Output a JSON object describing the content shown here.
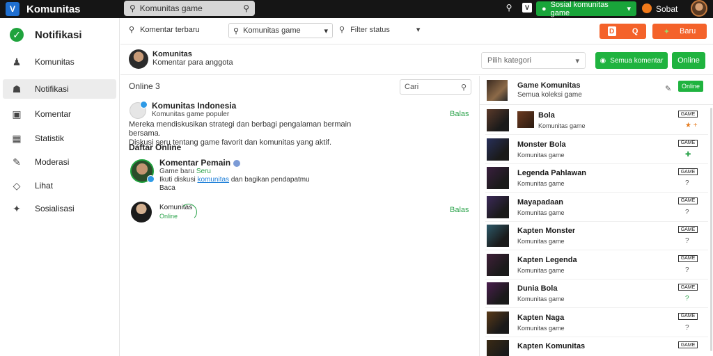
{
  "topbar": {
    "logo_letter": "V",
    "title": "Komunitas",
    "search_value": "Komunitas game",
    "green_button_label": "Sosial komunitas game",
    "username": "Sobat"
  },
  "sidebar": {
    "items": [
      {
        "label": "Notifikasi",
        "icon": "check-circle-icon"
      },
      {
        "label": "Komunitas",
        "icon": "users-icon"
      },
      {
        "label": "Notifikasi",
        "icon": "home-icon"
      },
      {
        "label": "Komentar",
        "icon": "inbox-icon"
      },
      {
        "label": "Statistik",
        "icon": "grid-icon"
      },
      {
        "label": "Moderasi",
        "icon": "pen-icon"
      },
      {
        "label": "Lihat",
        "icon": "tag-icon"
      },
      {
        "label": "Sosialisasi",
        "icon": "wrench-icon"
      }
    ]
  },
  "toolbar": {
    "filter_label": "Komentar terbaru",
    "select_value": "Komunitas game",
    "status_label": "Filter status",
    "orange_button": "Q",
    "orange_box_letter": "D",
    "orange2_label": "Baru"
  },
  "profile": {
    "name": "Komunitas",
    "subtitle": "Komentar para anggota",
    "select_placeholder": "Pilih kategori",
    "primary_button": "Semua komentar",
    "secondary_button": "Online"
  },
  "comments": {
    "header": "Online 3",
    "search_value": "Cari",
    "first": {
      "name": "Komunitas Indonesia",
      "meta": "Komunitas game populer",
      "reply": "Balas",
      "body_line1": "Mereka mendiskusikan strategi dan berbagi pengalaman bermain bersama.",
      "body_line2": "Diskusi seru tentang game favorit dan komunitas yang aktif."
    },
    "section_title": "Daftar Online",
    "second": {
      "name": "Komentar Pemain",
      "meta": "Game baru",
      "meta_tag": "Seru",
      "line_prefix": "Ikuti diskusi",
      "line_link": "komunitas",
      "line_suffix": "dan bagikan pendapatmu",
      "line2": "Baca"
    },
    "third": {
      "name": "Komunitas",
      "meta": "Online",
      "reply": "Balas"
    }
  },
  "right_panel": {
    "header": {
      "name": "Game Komunitas",
      "sub": "Semua koleksi game",
      "button": "Online"
    },
    "items": [
      {
        "title": "Bola",
        "meta": "Komunitas game",
        "tag": "GAME",
        "act": "★ +",
        "act_color": "orange",
        "thumb_color": "#5b3a2a"
      },
      {
        "title": "Monster Bola",
        "meta": "Komunitas game",
        "tag": "GAME",
        "act": "✚",
        "act_color": "green",
        "thumb_color": "#28305a"
      },
      {
        "title": "Legenda Pahlawan",
        "meta": "Komunitas game",
        "tag": "GAME",
        "act": "?",
        "act_color": "gray",
        "thumb_color": "#3a1f3f"
      },
      {
        "title": "Mayapadaan",
        "meta": "Komunitas game",
        "tag": "GAME",
        "act": "?",
        "act_color": "gray",
        "thumb_color": "#3c2a5a"
      },
      {
        "title": "Kapten Monster",
        "meta": "Komunitas game",
        "tag": "GAME",
        "act": "?",
        "act_color": "gray",
        "thumb_color": "#2d5a6a"
      },
      {
        "title": "Kapten Legenda",
        "meta": "Komunitas game",
        "tag": "GAME",
        "act": "?",
        "act_color": "gray",
        "thumb_color": "#40203a"
      },
      {
        "title": "Dunia Bola",
        "meta": "Komunitas game",
        "tag": "GAME",
        "act": "?",
        "act_color": "green",
        "thumb_color": "#4a1e4e"
      },
      {
        "title": "Kapten Naga",
        "meta": "Komunitas game",
        "tag": "GAME",
        "act": "?",
        "act_color": "gray",
        "thumb_color": "#5a3a18"
      },
      {
        "title": "Kapten Komunitas",
        "meta": "",
        "tag": "GAME",
        "act": "",
        "act_color": "gray",
        "thumb_color": "#3a2a14"
      }
    ]
  }
}
